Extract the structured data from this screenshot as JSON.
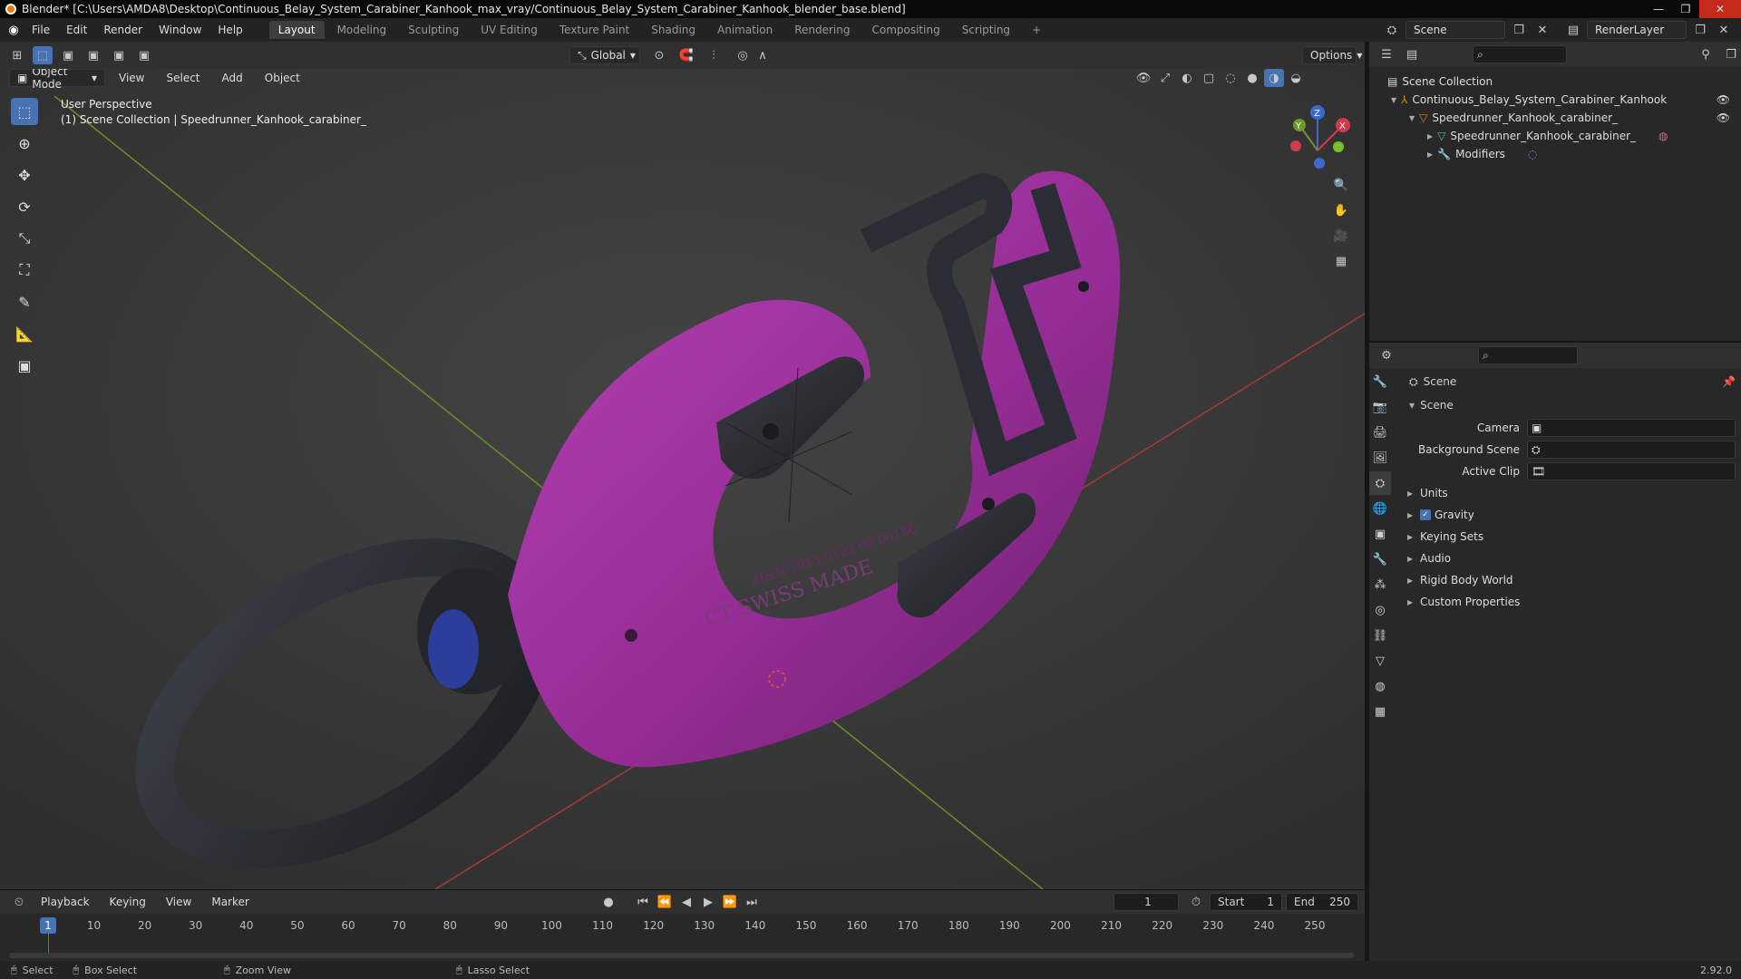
{
  "window": {
    "title": "Blender* [C:\\Users\\AMDA8\\Desktop\\Continuous_Belay_System_Carabiner_Kanhook_max_vray/Continuous_Belay_System_Carabiner_Kanhook_blender_base.blend]"
  },
  "menu": [
    "File",
    "Edit",
    "Render",
    "Window",
    "Help"
  ],
  "workspaces": [
    "Layout",
    "Modeling",
    "Sculpting",
    "UV Editing",
    "Texture Paint",
    "Shading",
    "Animation",
    "Rendering",
    "Compositing",
    "Scripting"
  ],
  "scene_name": "Scene",
  "render_layer": "RenderLayer",
  "toolbar": {
    "transform": "Global",
    "options": "Options"
  },
  "viewport": {
    "mode": "Object Mode",
    "menus": [
      "View",
      "Select",
      "Add",
      "Object"
    ],
    "overlay_line1": "User Perspective",
    "overlay_line2": "(1) Scene Collection | Speedrunner_Kanhook_carabiner_",
    "engraving1": "ZI&N 2013 0122 05 00186",
    "engraving2": "CT SWISS MADE",
    "gizmo": {
      "x": "X",
      "y": "Y",
      "z": "Z"
    }
  },
  "outliner": {
    "root": "Scene Collection",
    "collection": "Continuous_Belay_System_Carabiner_Kanhook",
    "object": "Speedrunner_Kanhook_carabiner_",
    "mesh": "Speedrunner_Kanhook_carabiner_",
    "modifiers": "Modifiers"
  },
  "properties": {
    "header": "Scene",
    "panel": "Scene",
    "camera_label": "Camera",
    "background_label": "Background Scene",
    "clip_label": "Active Clip",
    "sections": [
      "Units",
      "Gravity",
      "Keying Sets",
      "Audio",
      "Rigid Body World",
      "Custom Properties"
    ],
    "gravity_checked": true
  },
  "timeline": {
    "menus": [
      "Playback",
      "Keying",
      "View",
      "Marker"
    ],
    "current_frame": "1",
    "start_label": "Start",
    "start": "1",
    "end_label": "End",
    "end": "250",
    "ticks": [
      "1",
      "10",
      "20",
      "30",
      "40",
      "50",
      "60",
      "70",
      "80",
      "90",
      "100",
      "110",
      "120",
      "130",
      "140",
      "150",
      "160",
      "170",
      "180",
      "190",
      "200",
      "210",
      "220",
      "230",
      "240",
      "250"
    ]
  },
  "status": {
    "select": "Select",
    "box_select": "Box Select",
    "zoom_view": "Zoom View",
    "lasso_select": "Lasso Select",
    "version": "2.92.0"
  },
  "colors": {
    "accent": "#4772b3",
    "object": "#9c2e9c",
    "header": "#303030"
  }
}
